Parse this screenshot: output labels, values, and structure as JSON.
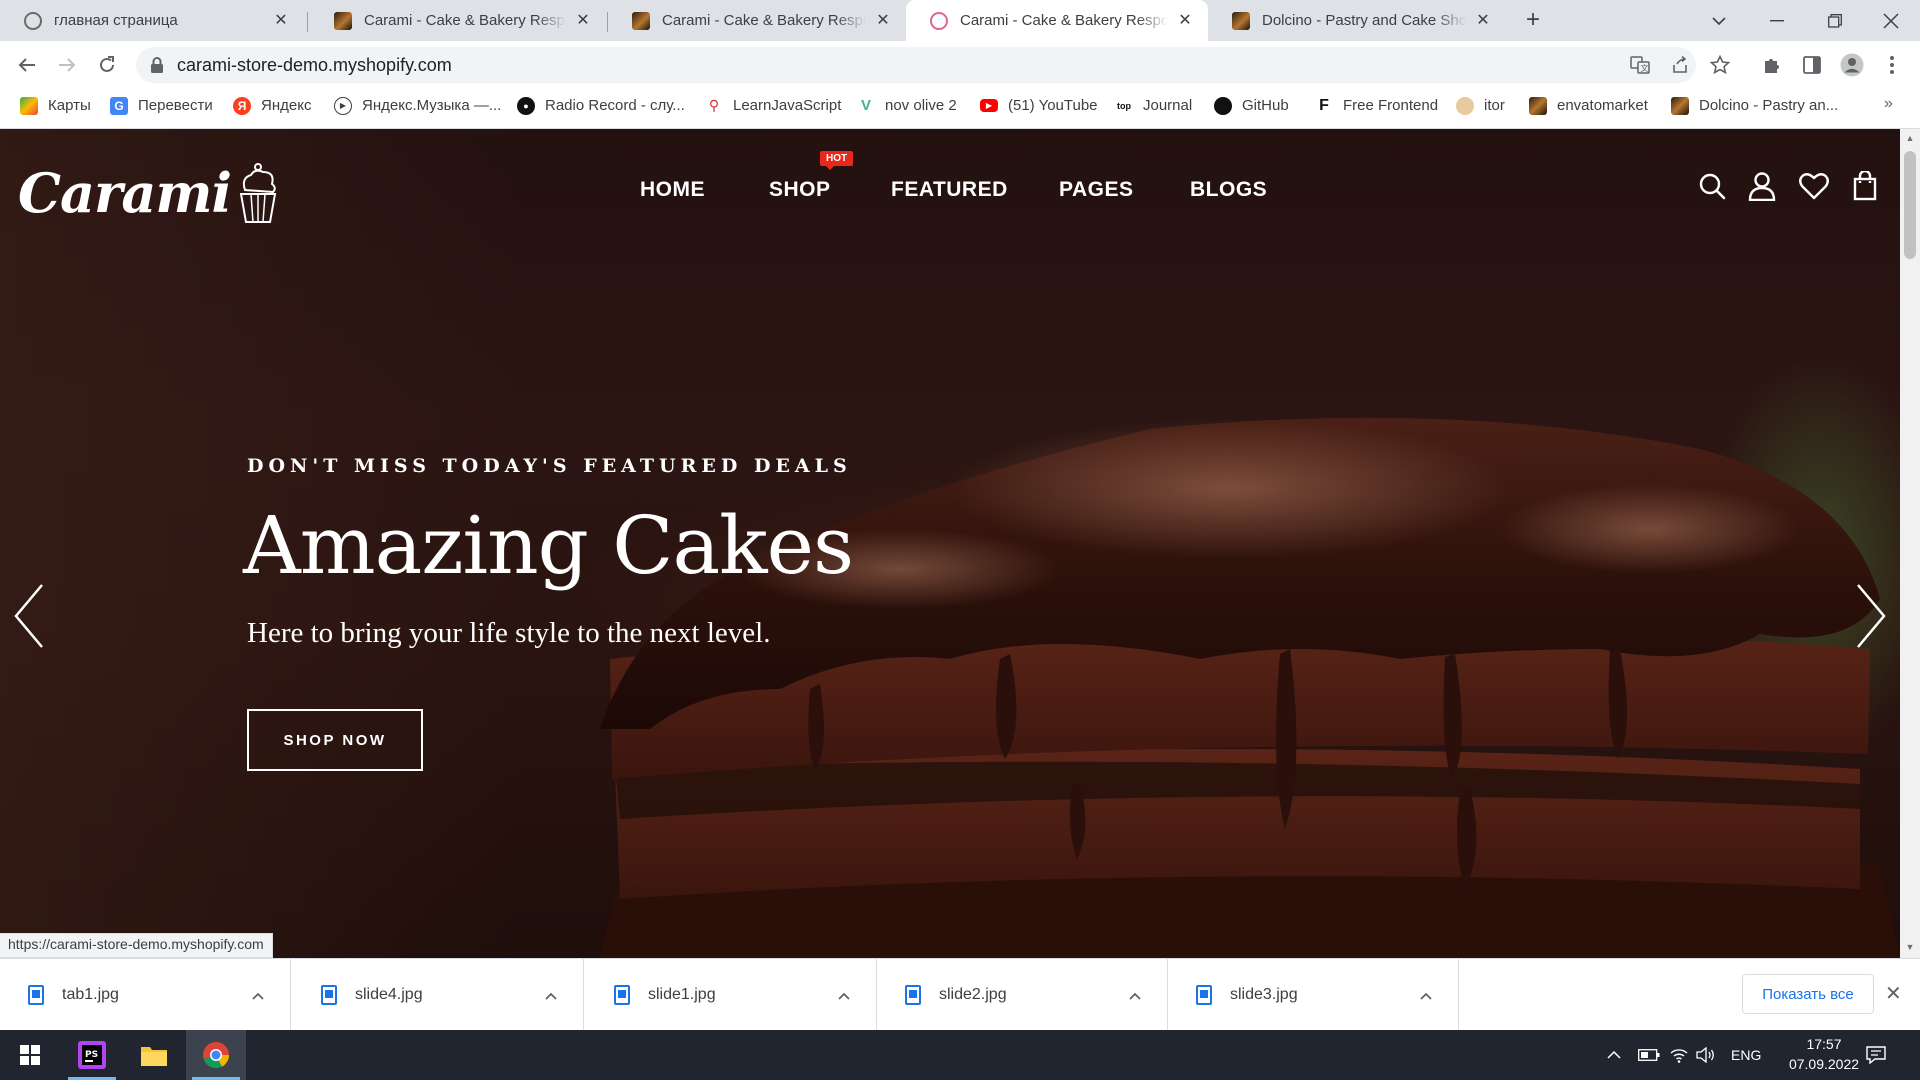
{
  "browser": {
    "tabs": [
      {
        "title": "главная страница",
        "favicon": "globe-icon"
      },
      {
        "title": "Carami - Cake & Bakery Responsive",
        "favicon": "cake-thumb-icon"
      },
      {
        "title": "Carami - Cake & Bakery Responsive",
        "favicon": "cake-thumb-icon"
      },
      {
        "title": "Carami - Cake & Bakery Responsive",
        "favicon": "carami-favicon",
        "active": true
      },
      {
        "title": "Dolcino - Pastry and Cake Shop T",
        "favicon": "cake-thumb-icon"
      }
    ],
    "tab_close": "✕",
    "new_tab": "+",
    "url": "carami-store-demo.myshopify.com",
    "bookmarks": [
      {
        "label": "Карты",
        "icon": "maps-icon"
      },
      {
        "label": "Перевести",
        "icon": "translate-icon"
      },
      {
        "label": "Яндекс",
        "icon": "yandex-icon"
      },
      {
        "label": "Яндекс.Музыка —...",
        "icon": "music-icon"
      },
      {
        "label": "Radio Record - слу...",
        "icon": "radio-icon"
      },
      {
        "label": "LearnJavaScript",
        "icon": "learnjs-icon"
      },
      {
        "label": "nov olive 2",
        "icon": "vue-icon"
      },
      {
        "label": "(51) YouTube",
        "icon": "youtube-icon"
      },
      {
        "label": "Journal",
        "icon": "journal-icon"
      },
      {
        "label": "GitHub",
        "icon": "github-icon"
      },
      {
        "label": "Free Frontend",
        "icon": "freefrontend-icon"
      },
      {
        "label": "itor",
        "icon": "itor-icon"
      },
      {
        "label": "envatomarket",
        "icon": "envato-icon"
      },
      {
        "label": "Dolcino - Pastry an...",
        "icon": "dolcino-icon"
      }
    ],
    "bookmarks_more": "»",
    "status_url": "https://carami-store-demo.myshopify.com"
  },
  "site": {
    "logo": "Carami",
    "nav": [
      "HOME",
      "SHOP",
      "FEATURED",
      "PAGES",
      "BLOGS"
    ],
    "hot_badge": "HOT",
    "hero": {
      "eyebrow": "DON'T MISS TODAY'S FEATURED DEALS",
      "title": "Amazing Cakes",
      "subtitle": "Here to bring your life style to the next level.",
      "cta": "SHOP NOW"
    }
  },
  "downloads": {
    "items": [
      "tab1.jpg",
      "slide4.jpg",
      "slide1.jpg",
      "slide2.jpg",
      "slide3.jpg"
    ],
    "chevron": "^",
    "show_all": "Показать все",
    "close": "✕"
  },
  "taskbar": {
    "apps": [
      "start-icon",
      "phpstorm-icon",
      "file-explorer-icon",
      "chrome-icon"
    ],
    "lang": "ENG",
    "time": "17:57",
    "date": "07.09.2022"
  },
  "colors": {
    "hero_bg": "#2a1410",
    "hot_badge": "#e8271e",
    "link_blue": "#1a73e8",
    "taskbar": "#20252f"
  }
}
